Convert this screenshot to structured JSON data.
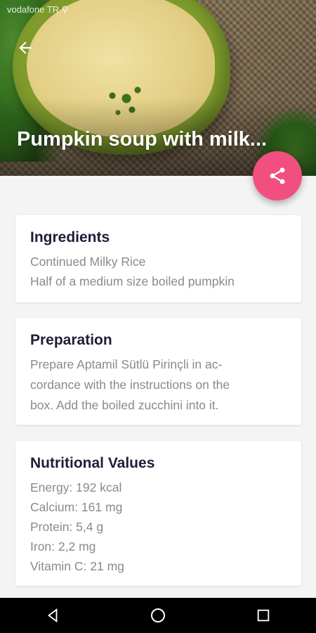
{
  "status_bar": {
    "carrier": "vodafone TR ⚲",
    "right_info": "(partially obscured status icons)"
  },
  "header": {
    "title": "Pumpkin soup with milk...",
    "back_icon": "arrow-left-icon",
    "share_icon": "share-icon",
    "accent_color": "#f14f7f"
  },
  "sections": {
    "ingredients": {
      "title": "Ingredients",
      "items": [
        "Continued Milky Rice",
        "Half of a medium size boiled pumpkin"
      ]
    },
    "preparation": {
      "title": "Preparation",
      "lines": [
        "Prepare Aptamil Sütlü Pirinçli in ac-",
        "cordance with the instructions on the",
        "box. Add the boiled zucchini into it."
      ]
    },
    "nutrition": {
      "title": "Nutritional Values",
      "items": [
        "Energy: 192 kcal",
        "Calcium: 161 mg",
        "Protein: 5,4 g",
        "Iron: 2,2 mg",
        "Vitamin C: 21 mg"
      ]
    }
  },
  "nav": {
    "back_icon": "triangle-back-icon",
    "home_icon": "circle-home-icon",
    "recents_icon": "square-recents-icon"
  }
}
